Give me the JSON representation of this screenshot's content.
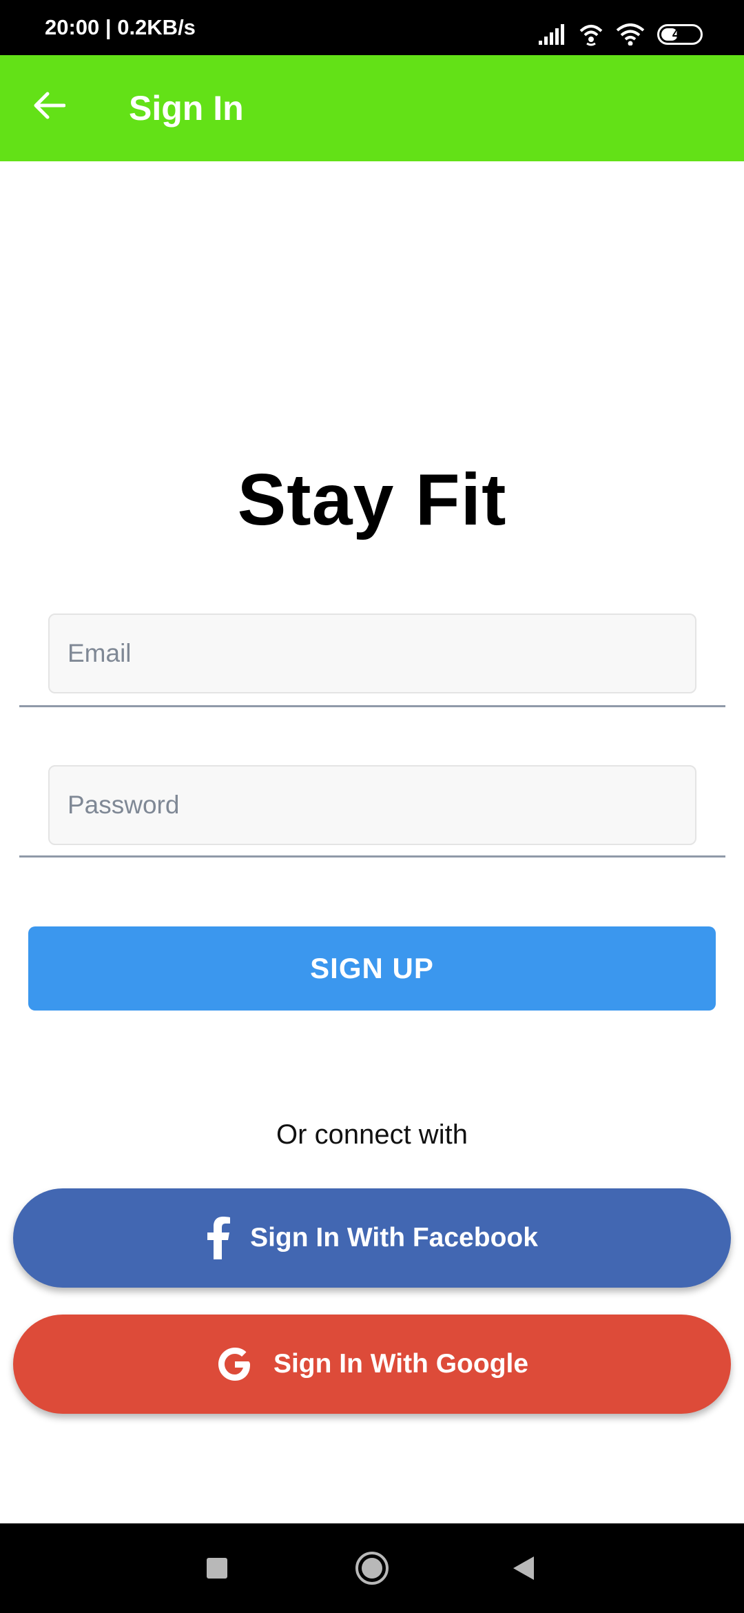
{
  "status_bar": {
    "time": "20:00",
    "separator": " | ",
    "speed": "0.2KB/s",
    "battery": "42",
    "icons": [
      "signal-icon",
      "hotspot-icon",
      "wifi-icon",
      "battery-icon"
    ]
  },
  "app_bar": {
    "title": "Sign In",
    "back_icon": "arrow-left-icon",
    "color": "#63e117"
  },
  "main": {
    "brand": "Stay Fit",
    "email": {
      "placeholder": "Email",
      "value": ""
    },
    "password": {
      "placeholder": "Password",
      "value": ""
    },
    "signup_label": "SIGN UP",
    "connect_text": "Or connect with",
    "facebook": {
      "label": "Sign In With Facebook",
      "icon": "facebook-icon",
      "color": "#4267b2"
    },
    "google": {
      "label": "Sign In With Google",
      "icon": "google-icon",
      "color": "#dd4b39"
    },
    "signup_color": "#3b97ee"
  },
  "nav_bar": {
    "icons": [
      "recent-apps-icon",
      "home-icon",
      "back-icon"
    ]
  }
}
